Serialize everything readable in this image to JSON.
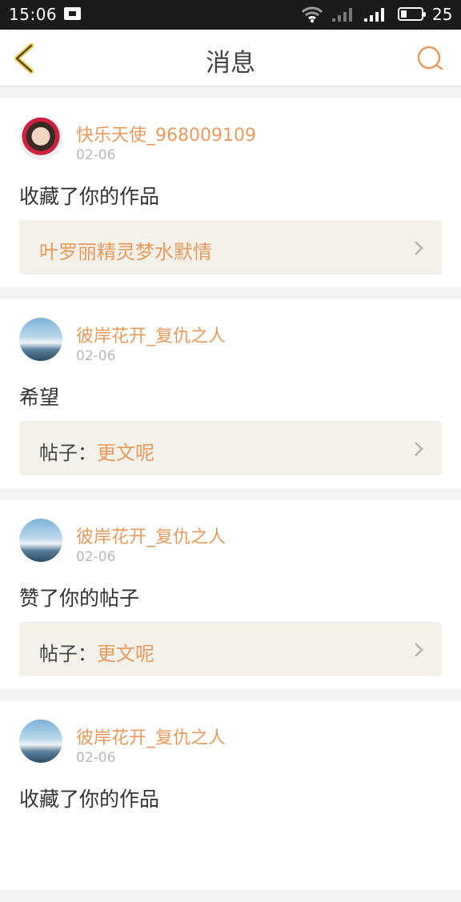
{
  "status_bar": {
    "time": "15:06",
    "battery": "25"
  },
  "header": {
    "title": "消息",
    "back_icon": "chevron-left-icon",
    "search_icon": "search-icon"
  },
  "colors": {
    "accent": "#ea9a5d",
    "link_bg": "#f3f1e9"
  },
  "messages": [
    {
      "username": "快乐天使_968009109",
      "date": "02-06",
      "action": "收藏了你的作品",
      "link_prefix": "",
      "link_text": "叶罗丽精灵梦水默情"
    },
    {
      "username": "彼岸花开_复仇之人",
      "date": "02-06",
      "action": "希望",
      "link_prefix": "帖子：",
      "link_text": "更文呢"
    },
    {
      "username": "彼岸花开_复仇之人",
      "date": "02-06",
      "action": "赞了你的帖子",
      "link_prefix": "帖子：",
      "link_text": "更文呢"
    },
    {
      "username": "彼岸花开_复仇之人",
      "date": "02-06",
      "action": "收藏了你的作品",
      "link_prefix": "",
      "link_text": ""
    }
  ]
}
